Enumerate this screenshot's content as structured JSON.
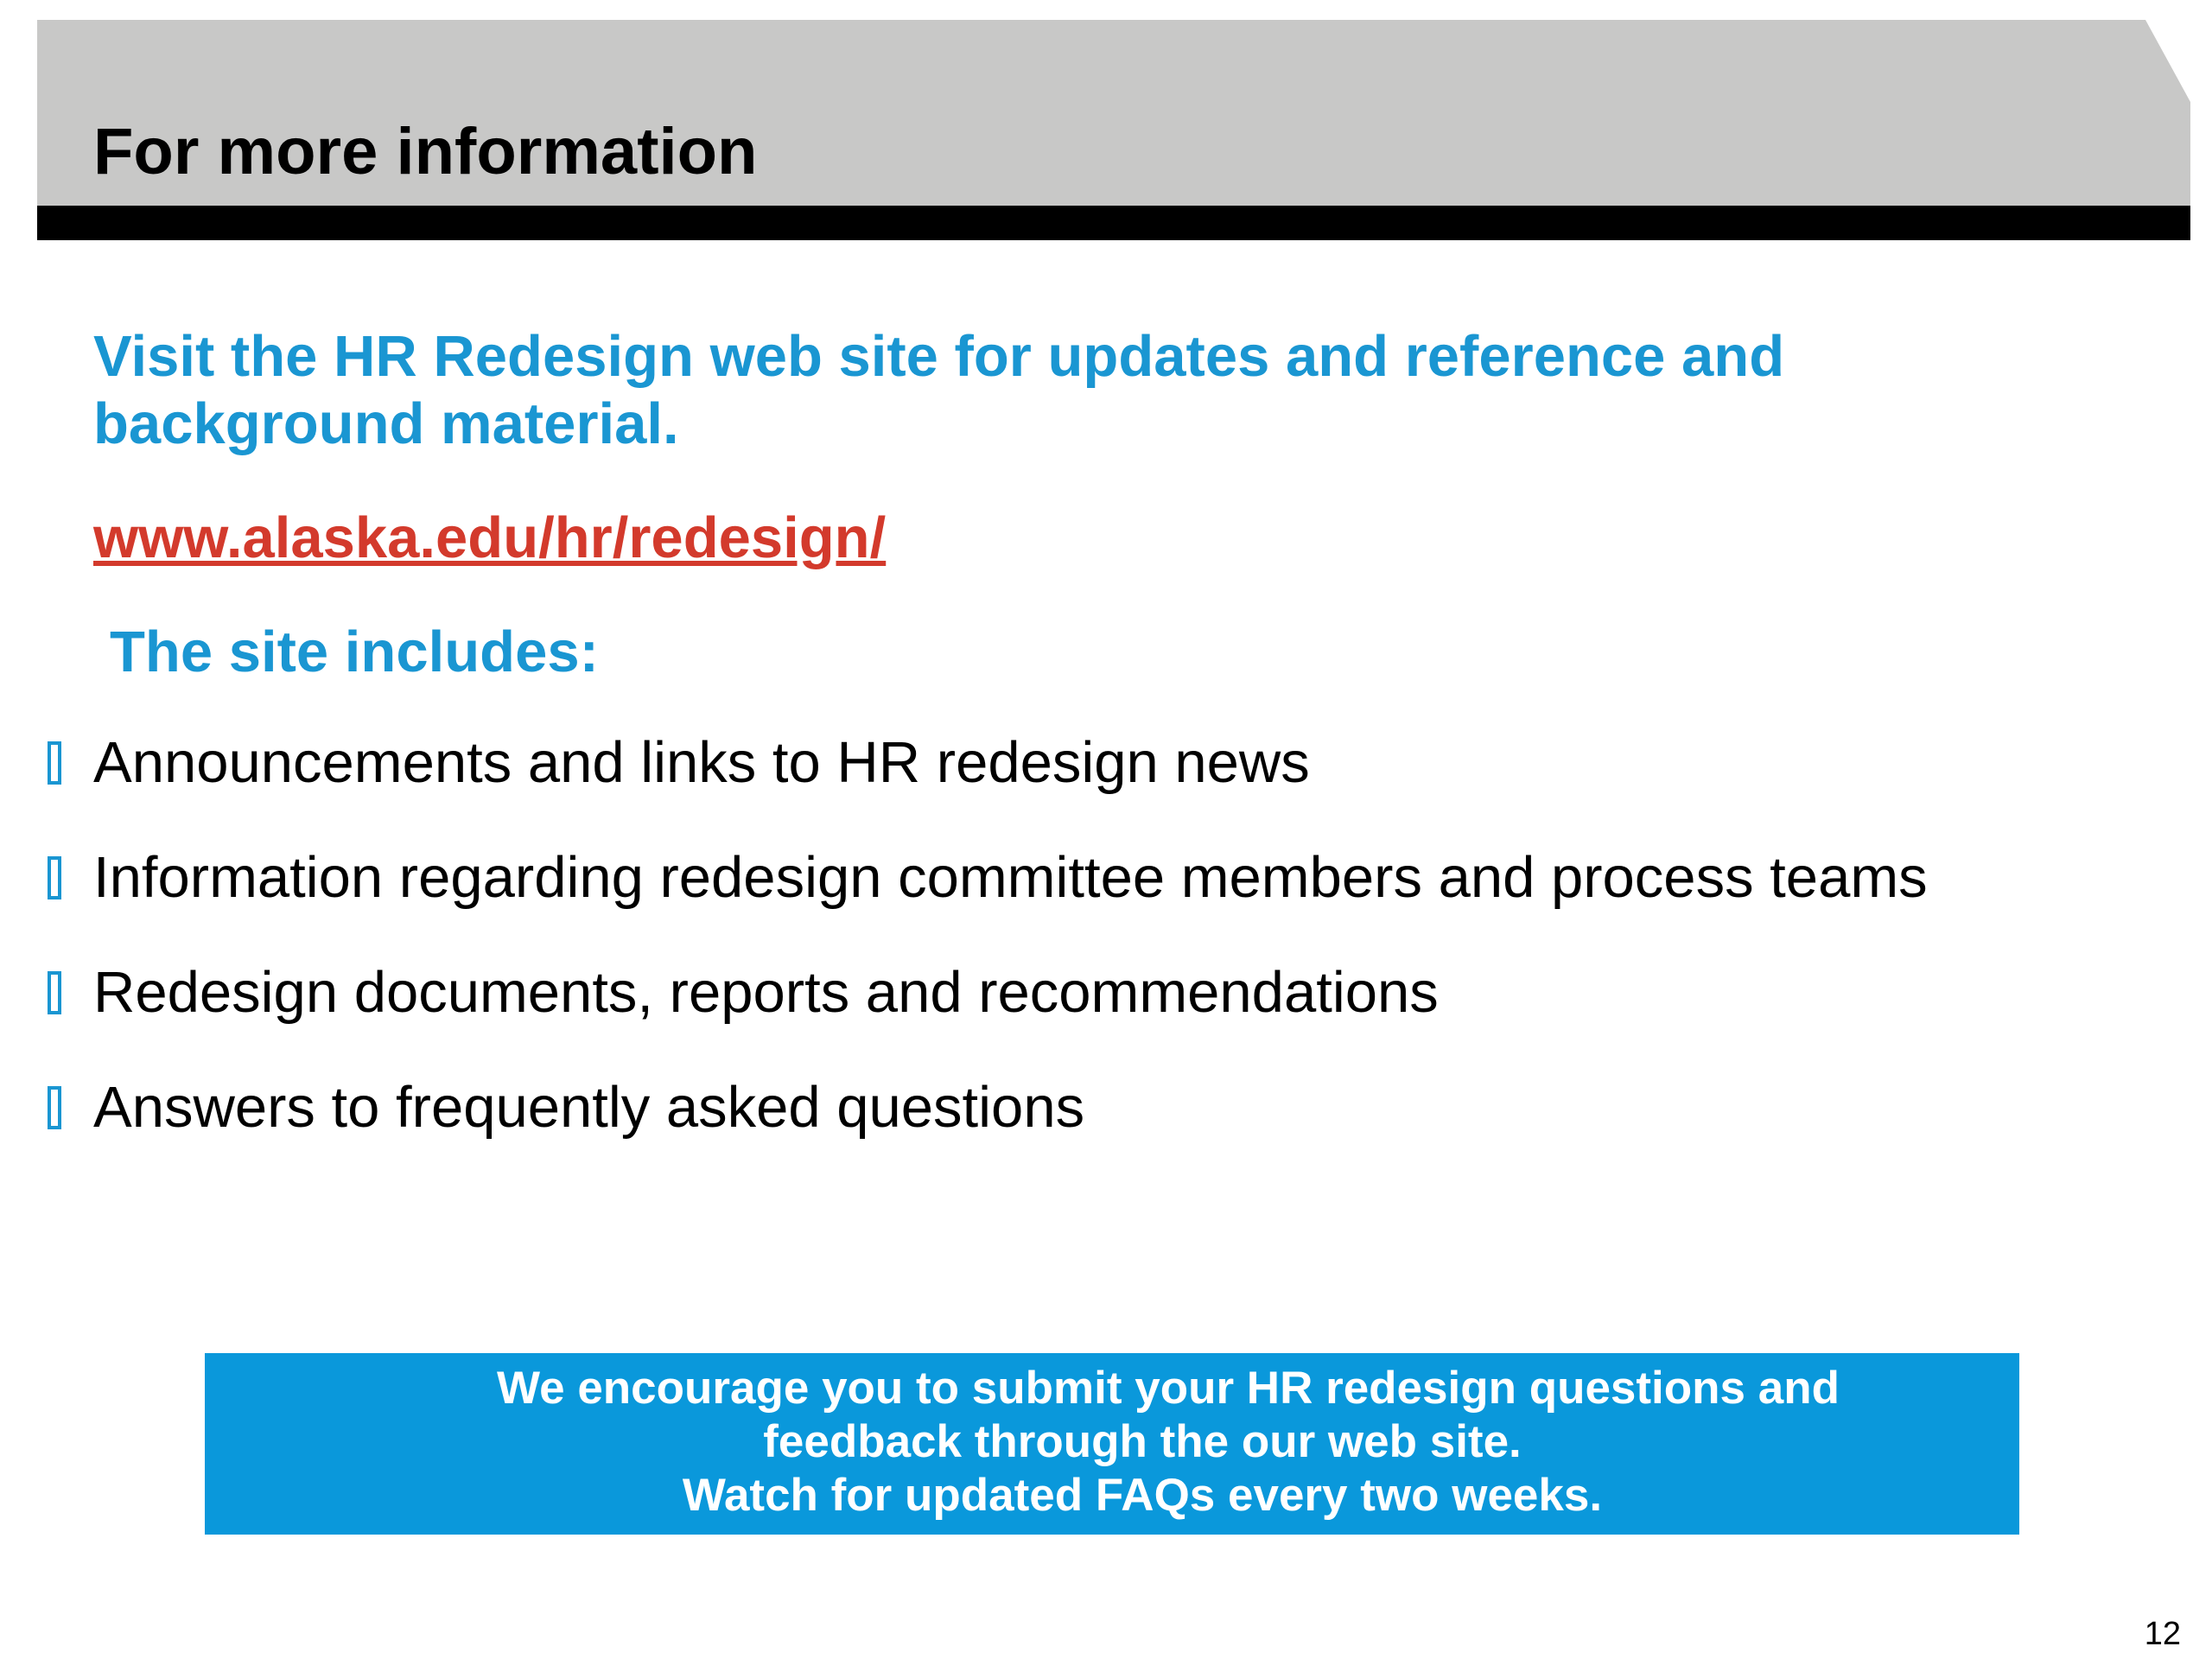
{
  "slide": {
    "title": "For more information",
    "intro": "Visit the HR Redesign web site for updates and reference and background material.",
    "link": "www.alaska.edu/hr/redesign/",
    "includes_heading": "The site includes:",
    "bullets": [
      "Announcements and links to HR redesign news",
      "Information regarding redesign committee members and process teams",
      "Redesign documents, reports and recommendations",
      "Answers to frequently asked questions"
    ],
    "callout": {
      "line1": "We encourage you to submit your HR redesign questions and",
      "line2": "feedback through the our web site.",
      "line3": "Watch for updated FAQs every two weeks."
    },
    "page_number": "12"
  },
  "icons": {
    "bullet": "square-outline-bullet-icon"
  },
  "colors": {
    "header_band": "#c8c8c7",
    "header_rule": "#000000",
    "accent_blue": "#1a96d2",
    "link_red": "#d33a2c",
    "callout_blue": "#0a98db"
  }
}
